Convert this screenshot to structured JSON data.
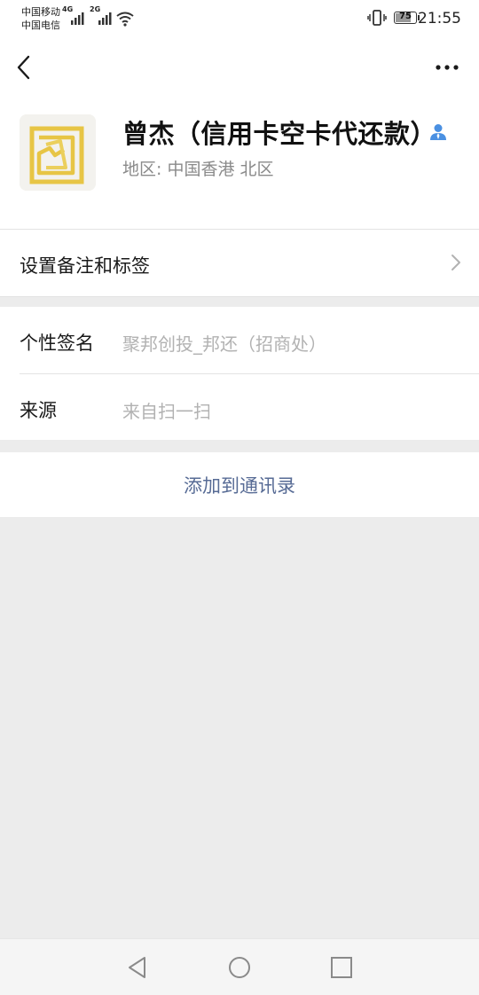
{
  "status_bar": {
    "carrier_1": "中国移动",
    "carrier_2": "中国电信",
    "network_1": "4G",
    "network_2": "2G",
    "battery_level": "75",
    "time": "21:55"
  },
  "nav": {
    "back_icon": "chevron-left-icon",
    "more_icon": "more-icon"
  },
  "profile": {
    "name": "曾杰（信用卡空卡代还款）",
    "region": "地区: 中国香港  北区",
    "avatar_accent": "#e8c84a"
  },
  "remark": {
    "label": "设置备注和标签"
  },
  "info": {
    "signature_label": "个性签名",
    "signature_value": "聚邦创投_邦还（招商处）",
    "source_label": "来源",
    "source_value": "来自扫一扫"
  },
  "actions": {
    "add_contact": "添加到通讯录"
  },
  "colors": {
    "link": "#576b95",
    "page_bg": "#ececec",
    "badge": "#4a90e2"
  }
}
